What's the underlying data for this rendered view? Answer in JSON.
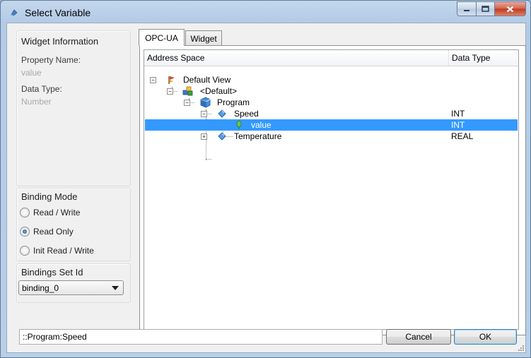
{
  "window": {
    "title": "Select Variable"
  },
  "widget_info": {
    "heading": "Widget Information",
    "property_name_label": "Property Name:",
    "property_name_value": "value",
    "data_type_label": "Data Type:",
    "data_type_value": "Number"
  },
  "binding_mode": {
    "heading": "Binding Mode",
    "options": [
      "Read / Write",
      "Read Only",
      "Init Read / Write"
    ],
    "selected": "Read Only"
  },
  "bindings_set": {
    "heading": "Bindings Set Id",
    "value": "binding_0"
  },
  "tabs": [
    "OPC-UA",
    "Widget"
  ],
  "active_tab": "OPC-UA",
  "tree": {
    "columns": [
      "Address Space",
      "Data Type"
    ],
    "rows": [
      {
        "label": "Default View",
        "type": "",
        "icon": "view-flag-icon",
        "expander": "minus"
      },
      {
        "label": "<Default>",
        "type": "",
        "icon": "namespace-icon",
        "expander": "minus"
      },
      {
        "label": "Program",
        "type": "",
        "icon": "program-cube-icon",
        "expander": "minus"
      },
      {
        "label": "Speed",
        "type": "INT",
        "icon": "variable-diamond-icon",
        "expander": "minus"
      },
      {
        "label": "value",
        "type": "INT",
        "icon": "value-leaf-icon",
        "expander": ""
      },
      {
        "label": "Temperature",
        "type": "REAL",
        "icon": "variable-diamond-icon",
        "expander": "plus"
      }
    ],
    "selected_row": "value"
  },
  "path_input": "::Program:Speed",
  "buttons": {
    "cancel": "Cancel",
    "ok": "OK"
  }
}
